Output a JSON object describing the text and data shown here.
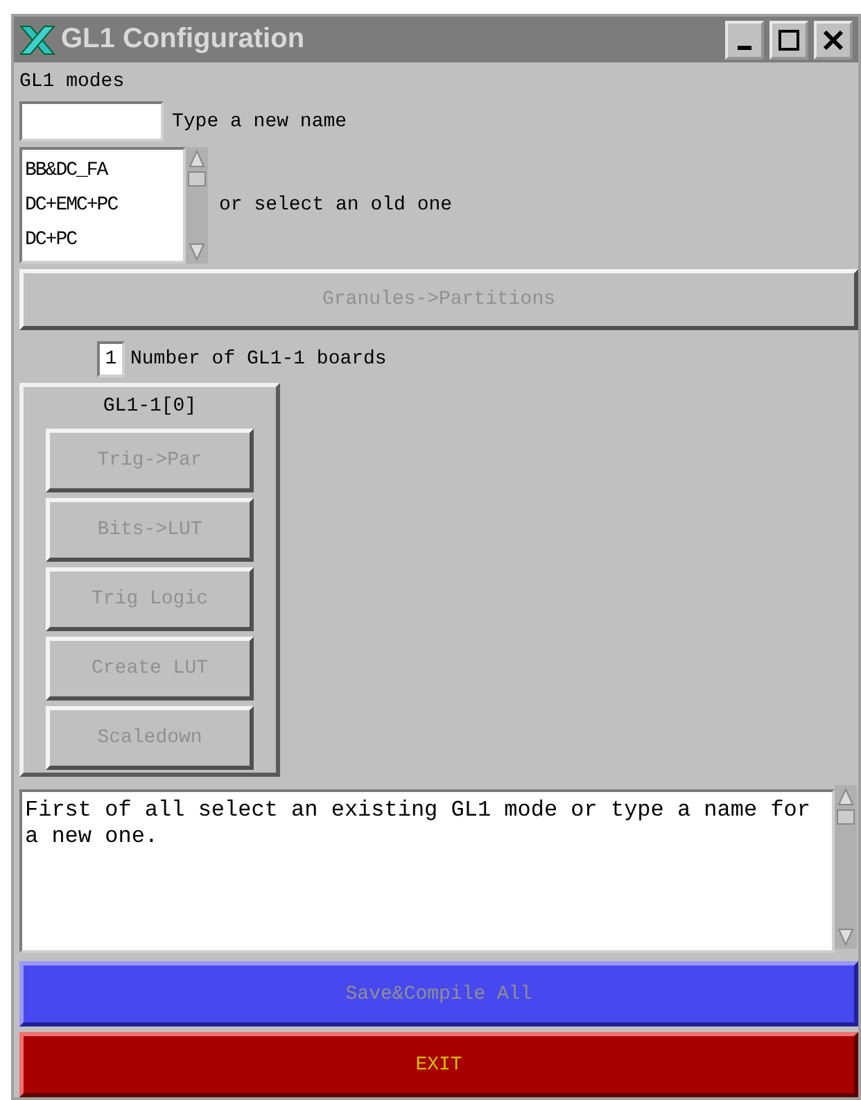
{
  "window": {
    "title": "GL1 Configuration"
  },
  "modes_label": "GL1 modes",
  "new_name_label": "Type a new name",
  "old_modes": {
    "label": "or select an old one",
    "items": [
      {
        "label": "BB&DC_FA",
        "selected": false
      },
      {
        "label": "DC+EMC+PC",
        "selected": false
      },
      {
        "label": "DC+PC",
        "selected": false
      }
    ]
  },
  "granules_button": {
    "label": "Granules->Partitions",
    "disabled": true
  },
  "boards": {
    "count": "1",
    "label": "Number of GL1-1 boards"
  },
  "board_panels": [
    {
      "title": "GL1-1[0]",
      "buttons": [
        {
          "label": "Trig->Par",
          "disabled": true
        },
        {
          "label": "Bits->LUT",
          "disabled": true
        },
        {
          "label": "Trig Logic",
          "disabled": true
        },
        {
          "label": "Create LUT",
          "disabled": true
        },
        {
          "label": "Scaledown",
          "disabled": true
        }
      ]
    }
  ],
  "message": "First of all select an existing GL1 mode or type a name for a new one.",
  "buttons": [
    {
      "kind": "save",
      "label": "Save&Compile All",
      "disabled": true
    },
    {
      "kind": "exit",
      "label": "EXIT",
      "disabled": false
    }
  ]
}
